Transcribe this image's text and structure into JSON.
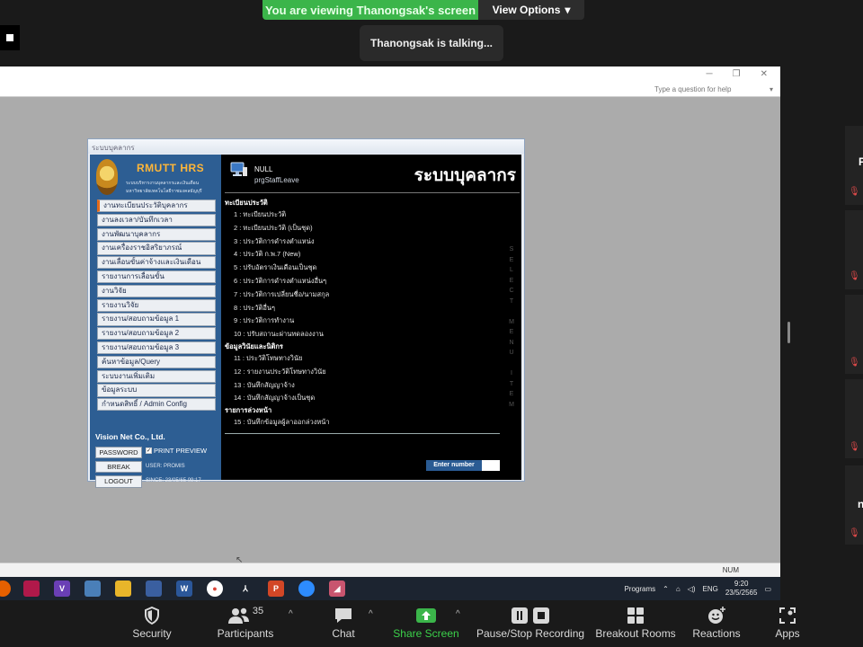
{
  "zoom": {
    "banner": "You are viewing Thanongsak's screen",
    "view_options": "View Options",
    "talking": "Thanongsak is talking...",
    "toolbar": {
      "security": "Security",
      "participants": "Participants",
      "participants_count": "35",
      "chat": "Chat",
      "share_screen": "Share Screen",
      "record": "Pause/Stop Recording",
      "breakout": "Breakout Rooms",
      "reactions": "Reactions",
      "apps": "Apps"
    },
    "strip_letters": [
      "P",
      "n"
    ]
  },
  "excel": {
    "help_placeholder": "Type a question for help",
    "status": "NUM"
  },
  "hrs": {
    "title_bar": "ระบบบุคลากร",
    "logo": {
      "name": "RMUTT HRS",
      "subtitle1": "ระบบบริหารงานบุคลากรและเงินเดือน",
      "subtitle2": "มหาวิทยาลัยเทคโนโลยีราชมงคลธัญบุรี"
    },
    "menu": [
      "งานทะเบียนประวัติบุคลากร",
      "งานลงเวลา/บันทึกเวลา",
      "งานพัฒนาบุคลากร",
      "งานเครื่องราชอิสริยาภรณ์",
      "งานเลื่อนขั้นค่าจ้างและเงินเดือน",
      "รายงานการเลื่อนขั้น",
      "งานวิจัย",
      "รายงานวิจัย",
      "รายงาน/สอบถามข้อมูล 1",
      "รายงาน/สอบถามข้อมูล 2",
      "รายงาน/สอบถามข้อมูล 3",
      "ค้นหาข้อมูล/Query",
      "ระบบงานเพิ่มเติม",
      "ข้อมูลระบบ",
      "กำหนดสิทธิ์ / Admin Config"
    ],
    "company": "Vision Net Co., Ltd.",
    "password_btn": "PASSWORD",
    "print_preview": "PRINT PREVIEW",
    "break_btn": "BREAK",
    "logout_btn": "LOGOUT",
    "user_line": "USER: PROMIS",
    "since_line": "SINCE: 23/05/65 09:17",
    "null_label": "NULL",
    "prg_label": "prgStaffLeave",
    "system_title": "ระบบบุคลากร",
    "sections": [
      {
        "heading": "ทะเบียนประวัติ",
        "items": [
          "1 : ทะเบียนประวัติ",
          "2 : ทะเบียนประวัติ (เป็นชุด)",
          "3 : ประวัติการดำรงตำแหน่ง",
          "4 : ประวัติ ก.พ.7 (New)",
          "5 : ปรับอัตราเงินเดือนเป็นชุด",
          "6 : ประวัติการดำรงตำแหน่งอื่นๆ",
          "7 : ประวัติการเปลี่ยนชื่อ/นามสกุล",
          "8 : ประวัติอื่นๆ",
          "9 : ประวัติการทำงาน",
          "10 : ปรับสถานะผ่านทดลองงาน"
        ]
      },
      {
        "heading": "ข้อมูลวินัยและนิติกร",
        "items": [
          "11 : ประวัติโทษทางวินัย",
          "12 : รายงานประวัติโทษทางวินัย",
          "13 : บันทึกสัญญาจ้าง",
          "14 : บันทึกสัญญาจ้างเป็นชุด"
        ]
      },
      {
        "heading": "รายการล่วงหน้า",
        "items": [
          "15 : บันทึกข้อมูลผู้ลาออกล่วงหน้า"
        ]
      }
    ],
    "vertical_text": "SELECT MENU ITEM",
    "enter_label": "Enter number"
  },
  "taskbar": {
    "programs": "Programs",
    "lang": "ENG",
    "time": "9:20",
    "date": "23/5/2565"
  }
}
